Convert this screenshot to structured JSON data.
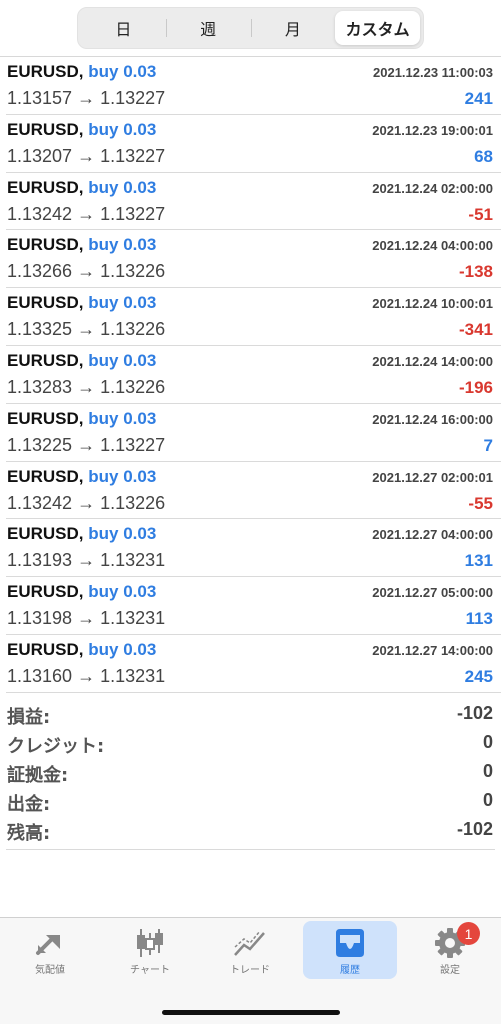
{
  "period_tabs": [
    {
      "label": "日",
      "active": false
    },
    {
      "label": "週",
      "active": false
    },
    {
      "label": "月",
      "active": false
    },
    {
      "label": "カスタム",
      "active": true
    }
  ],
  "trades": [
    {
      "symbol": "EURUSD,",
      "side": "buy 0.03",
      "time": "2021.12.23 11:00:03",
      "prices": "1.13157 → 1.13227",
      "profit": "241",
      "positive": true
    },
    {
      "symbol": "EURUSD,",
      "side": "buy 0.03",
      "time": "2021.12.23 19:00:01",
      "prices": "1.13207 → 1.13227",
      "profit": "68",
      "positive": true
    },
    {
      "symbol": "EURUSD,",
      "side": "buy 0.03",
      "time": "2021.12.24 02:00:00",
      "prices": "1.13242 → 1.13227",
      "profit": "-51",
      "positive": false
    },
    {
      "symbol": "EURUSD,",
      "side": "buy 0.03",
      "time": "2021.12.24 04:00:00",
      "prices": "1.13266 → 1.13226",
      "profit": "-138",
      "positive": false
    },
    {
      "symbol": "EURUSD,",
      "side": "buy 0.03",
      "time": "2021.12.24 10:00:01",
      "prices": "1.13325 → 1.13226",
      "profit": "-341",
      "positive": false
    },
    {
      "symbol": "EURUSD,",
      "side": "buy 0.03",
      "time": "2021.12.24 14:00:00",
      "prices": "1.13283 → 1.13226",
      "profit": "-196",
      "positive": false
    },
    {
      "symbol": "EURUSD,",
      "side": "buy 0.03",
      "time": "2021.12.24 16:00:00",
      "prices": "1.13225 → 1.13227",
      "profit": "7",
      "positive": true
    },
    {
      "symbol": "EURUSD,",
      "side": "buy 0.03",
      "time": "2021.12.27 02:00:01",
      "prices": "1.13242 → 1.13226",
      "profit": "-55",
      "positive": false
    },
    {
      "symbol": "EURUSD,",
      "side": "buy 0.03",
      "time": "2021.12.27 04:00:00",
      "prices": "1.13193 → 1.13231",
      "profit": "131",
      "positive": true
    },
    {
      "symbol": "EURUSD,",
      "side": "buy 0.03",
      "time": "2021.12.27 05:00:00",
      "prices": "1.13198 → 1.13231",
      "profit": "113",
      "positive": true
    },
    {
      "symbol": "EURUSD,",
      "side": "buy 0.03",
      "time": "2021.12.27 14:00:00",
      "prices": "1.13160 → 1.13231",
      "profit": "245",
      "positive": true
    }
  ],
  "summary": [
    {
      "label": "損益:",
      "value": "-102"
    },
    {
      "label": "クレジット:",
      "value": "0"
    },
    {
      "label": "証拠金:",
      "value": "0"
    },
    {
      "label": "出金:",
      "value": "0"
    },
    {
      "label": "残高:",
      "value": "-102"
    }
  ],
  "bottom_tabs": [
    {
      "label": "気配値",
      "icon": "quotes-arrows-icon",
      "active": false
    },
    {
      "label": "チャート",
      "icon": "candlestick-chart-icon",
      "active": false
    },
    {
      "label": "トレード",
      "icon": "trade-line-icon",
      "active": false
    },
    {
      "label": "履歴",
      "icon": "history-inbox-icon",
      "active": true
    },
    {
      "label": "設定",
      "icon": "gear-icon",
      "active": false,
      "badge": "1"
    }
  ],
  "colors": {
    "positive": "#2f7de1",
    "negative": "#d9382f",
    "active_tab_bg": "#cfe2fb",
    "badge": "#e4463d"
  }
}
